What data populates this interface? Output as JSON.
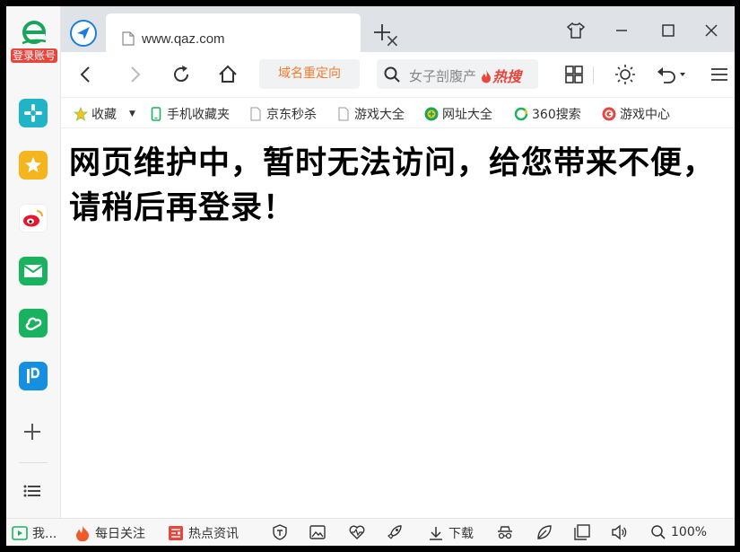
{
  "sidebar": {
    "login_label": "登录账号",
    "items": [
      "plugin-icon",
      "favorites-icon",
      "weibo-icon",
      "mail-icon",
      "cloud-icon",
      "pdf-icon"
    ]
  },
  "tab": {
    "title": "www.qaz.com"
  },
  "toolbar": {
    "redirect_label": "域名重定向",
    "search_text": "女子剖腹产",
    "hot_label": "热搜"
  },
  "bookmarks": [
    {
      "label": "收藏",
      "icon": "star-icon"
    },
    {
      "label": "手机收藏夹",
      "icon": "phone-icon"
    },
    {
      "label": "京东秒杀",
      "icon": "doc-icon"
    },
    {
      "label": "游戏大全",
      "icon": "doc-icon"
    },
    {
      "label": "网址大全",
      "icon": "web-nav-icon"
    },
    {
      "label": "360搜索",
      "icon": "360-search-icon"
    },
    {
      "label": "游戏中心",
      "icon": "game-center-icon"
    }
  ],
  "content": {
    "message": "网页维护中，暂时无法访问，给您带来不便，请稍后再登录！"
  },
  "statusbar": {
    "player_label": "我...",
    "daily_label": "每日关注",
    "news_label": "热点资讯",
    "download_label": "下载",
    "zoom": "100%"
  },
  "colors": {
    "accent_orange": "#f07c2e",
    "hot_red": "#e8453c",
    "tab_bar": "#dfe3e8",
    "logo_green": "#1aa35c"
  }
}
